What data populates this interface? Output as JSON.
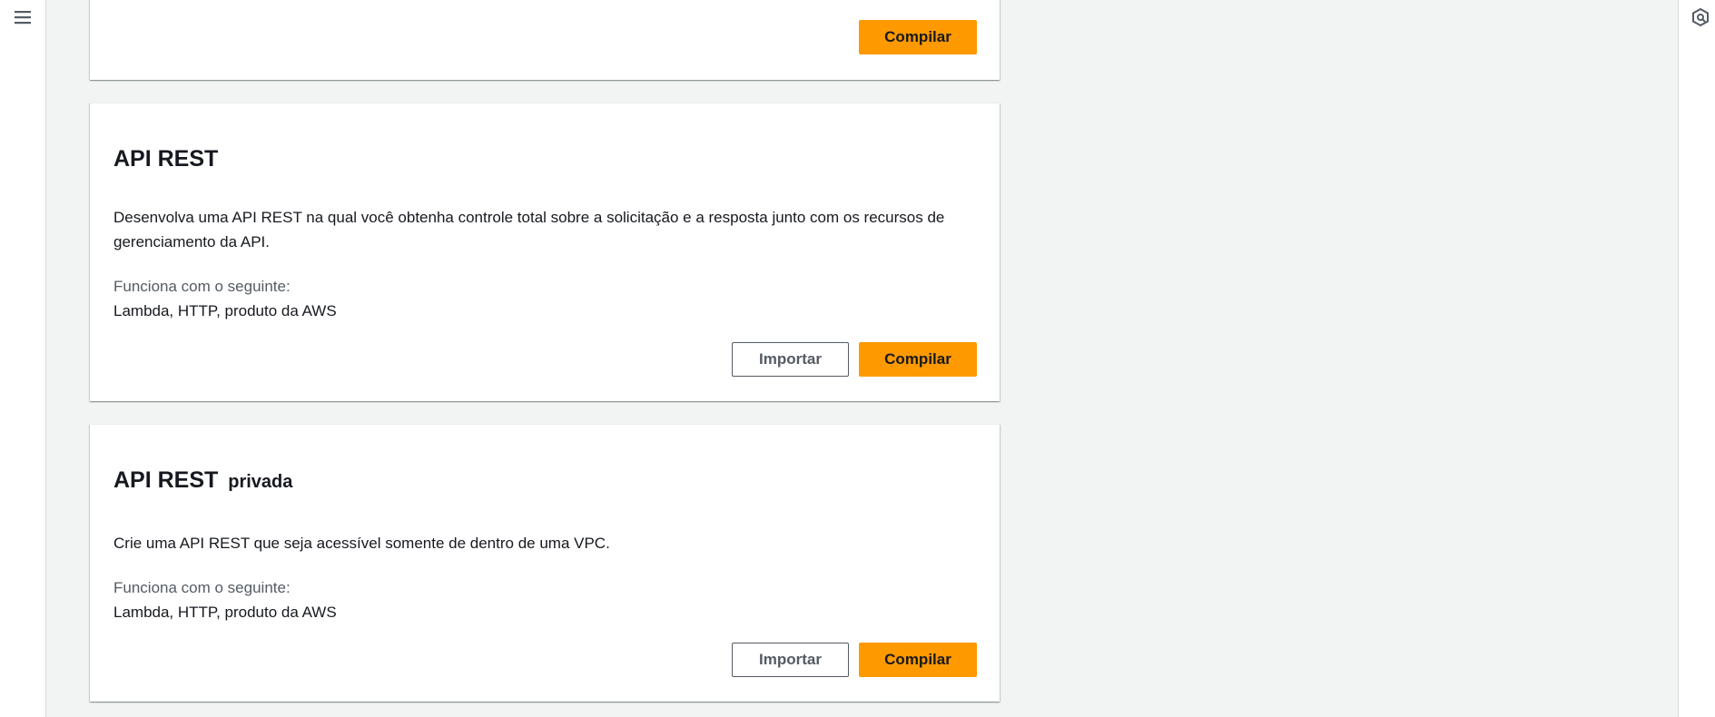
{
  "nav": {
    "menu_icon": "hamburger-menu-icon",
    "help_icon": "help-panel-icon"
  },
  "colors": {
    "primary": "#ff9900",
    "background": "#f2f3f3",
    "text": "#16191f",
    "muted": "#545b64"
  },
  "cards": {
    "top": {
      "build_label": "Compilar"
    },
    "rest": {
      "title": "API REST",
      "description": "Desenvolva uma API REST na qual você obtenha controle total sobre a solicitação e a resposta junto com os recursos de gerenciamento da API.",
      "works_with_label": "Funciona com o seguinte:",
      "works_with_value": "Lambda, HTTP, produto da AWS",
      "import_label": "Importar",
      "build_label": "Compilar"
    },
    "private": {
      "title": "API REST",
      "title_suffix": "privada",
      "description": "Crie uma API REST que seja acessível somente de dentro de uma VPC.",
      "works_with_label": "Funciona com o seguinte:",
      "works_with_value": "Lambda, HTTP, produto da AWS",
      "import_label": "Importar",
      "build_label": "Compilar"
    }
  }
}
